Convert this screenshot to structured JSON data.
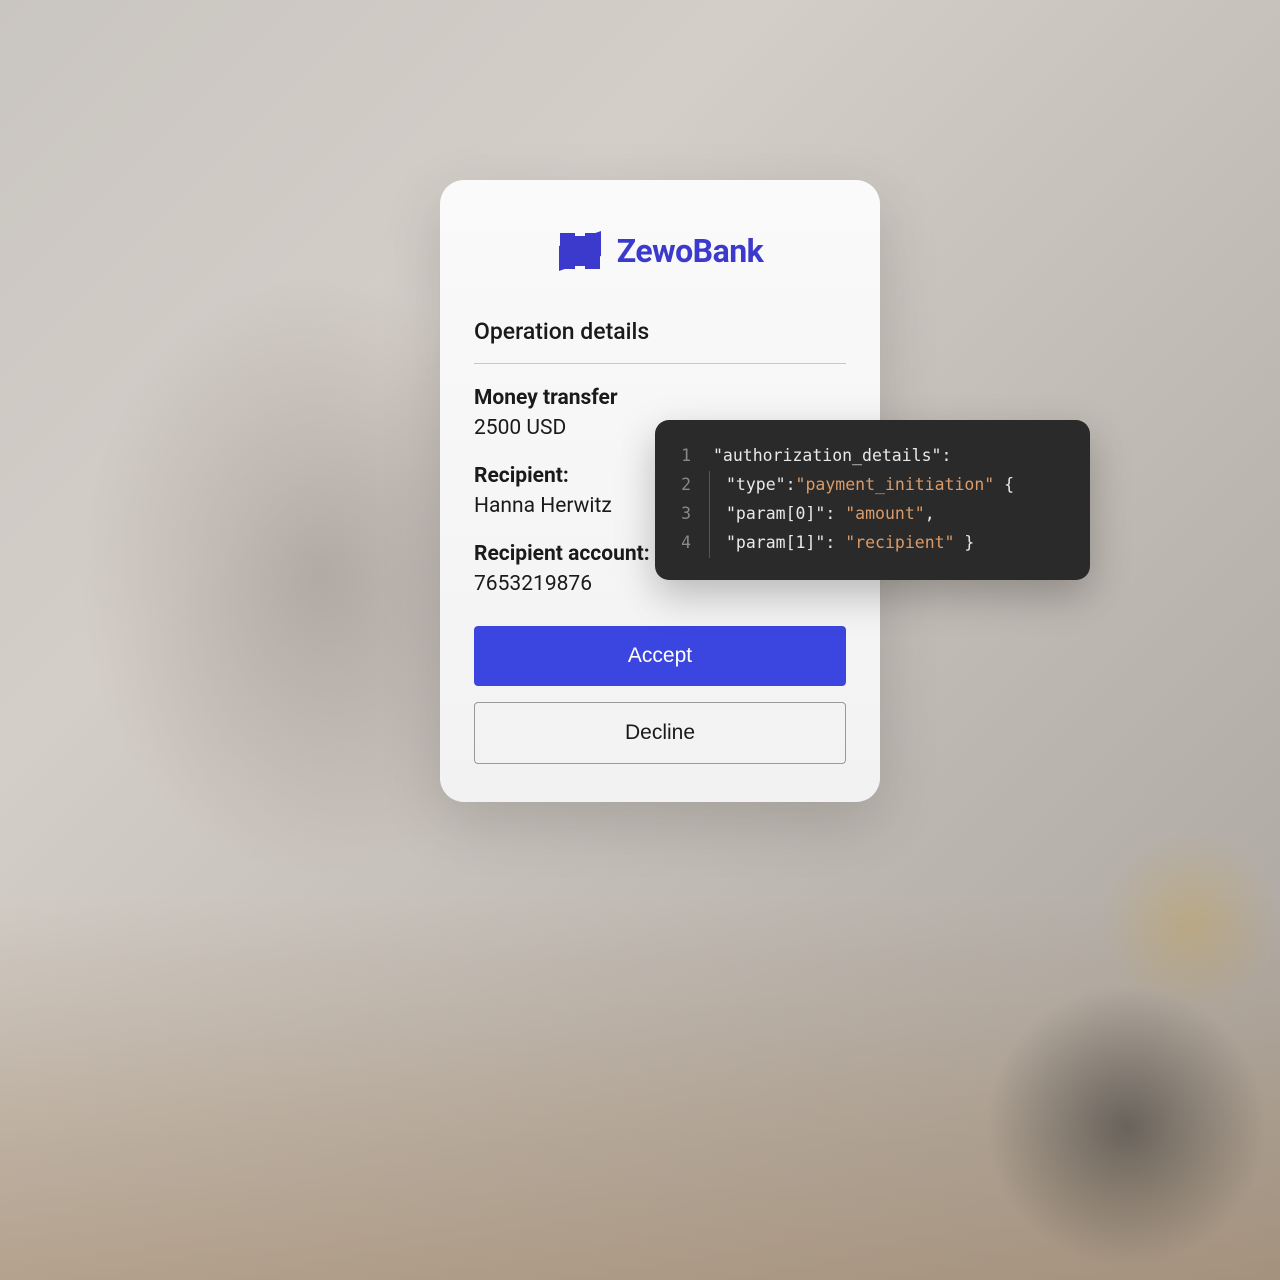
{
  "brand": {
    "name": "ZewoBank",
    "color": "#3b3acc"
  },
  "card": {
    "section_title": "Operation details",
    "groups": [
      {
        "label": "Money transfer",
        "value": "2500 USD"
      },
      {
        "label": "Recipient:",
        "value": "Hanna Herwitz"
      },
      {
        "label": "Recipient account:",
        "value": "7653219876"
      }
    ],
    "accept_label": "Accept",
    "decline_label": "Decline"
  },
  "code": {
    "lines": [
      {
        "num": "1",
        "segments": [
          {
            "t": "\"authorization_details\"",
            "c": "key"
          },
          {
            "t": ":",
            "c": "punc"
          }
        ]
      },
      {
        "num": "2",
        "segments": [
          {
            "t": "\"type\"",
            "c": "key"
          },
          {
            "t": ":",
            "c": "punc"
          },
          {
            "t": "\"payment_initiation\"",
            "c": "str"
          },
          {
            "t": " {",
            "c": "punc"
          }
        ]
      },
      {
        "num": "3",
        "segments": [
          {
            "t": "\"param[0]\"",
            "c": "key"
          },
          {
            "t": ": ",
            "c": "punc"
          },
          {
            "t": "\"amount\"",
            "c": "str"
          },
          {
            "t": ",",
            "c": "punc"
          }
        ]
      },
      {
        "num": "4",
        "segments": [
          {
            "t": "\"param[1]\"",
            "c": "key"
          },
          {
            "t": ": ",
            "c": "punc"
          },
          {
            "t": "\"recipient\"",
            "c": "str"
          },
          {
            "t": " }",
            "c": "punc"
          }
        ]
      }
    ]
  }
}
